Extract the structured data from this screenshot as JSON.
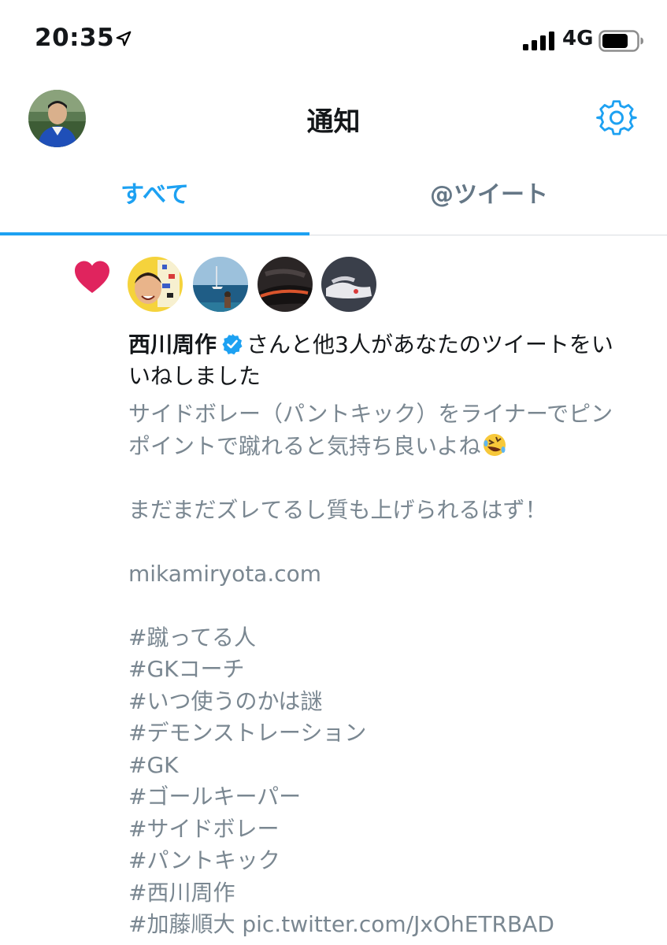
{
  "status_bar": {
    "time": "20:35",
    "network": "4G",
    "icons": [
      "location-arrow-icon",
      "signal-bars-icon",
      "battery-icon"
    ]
  },
  "header": {
    "title": "通知",
    "settings_icon": "gear-icon"
  },
  "tabs": [
    {
      "label": "すべて",
      "active": true
    },
    {
      "label": "@ツイート",
      "active": false
    }
  ],
  "notification": {
    "type_icon": "heart-icon",
    "actor_avatars": 4,
    "actor_name": "西川周作",
    "message": "さんと他3人があなたのツイートをいいねしました",
    "tweet_lines": [
      "サイドボレー（パントキック）をライナーでピンポイントで蹴れると気持ち良いよね",
      "",
      "まだまだズレてるし質も上げられるはず！",
      "",
      "mikamiryota.com",
      "",
      "#蹴ってる人",
      "#GKコーチ",
      "#いつ使うのかは謎",
      "#デモンストレーション",
      "#GK",
      "#ゴールキーパー",
      "#サイドボレー",
      "#パントキック",
      "#西川周作",
      "#加藤順大 pic.twitter.com/JxOhETRBAD"
    ]
  },
  "colors": {
    "accent": "#1da1f2",
    "heart": "#e0245e",
    "secondary_text": "#7a8791"
  }
}
